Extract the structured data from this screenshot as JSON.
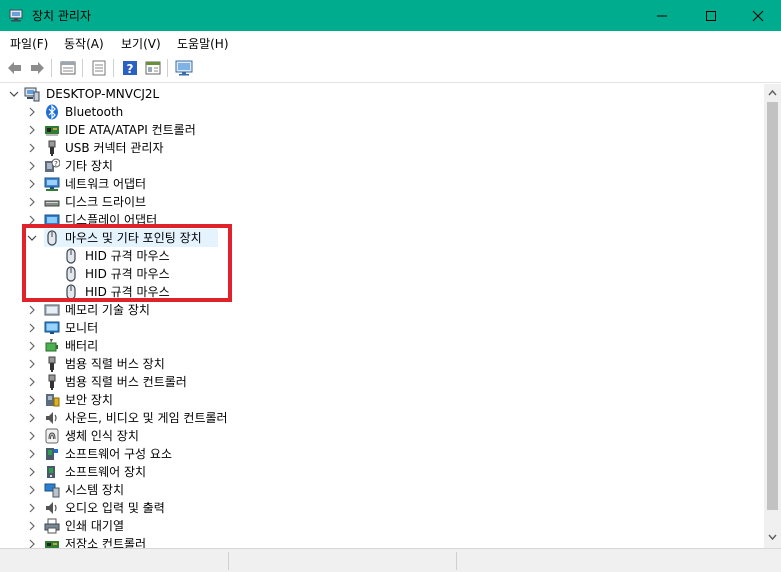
{
  "window": {
    "title": "장치 관리자",
    "accent_color": "#00ac8e"
  },
  "menu": [
    {
      "label": "파일(F)"
    },
    {
      "label": "동작(A)"
    },
    {
      "label": "보기(V)"
    },
    {
      "label": "도움말(H)"
    }
  ],
  "toolbar": {
    "icons": [
      "back-arrow-icon",
      "forward-arrow-icon",
      "properties-icon",
      "update-driver-icon",
      "help-icon",
      "view-icon",
      "monitor-scan-icon"
    ]
  },
  "tree": {
    "root": "DESKTOP-MNVCJ2L",
    "categories": [
      {
        "label": "Bluetooth",
        "icon": "bluetooth-icon"
      },
      {
        "label": "IDE ATA/ATAPI 컨트롤러",
        "icon": "ide-controller-icon"
      },
      {
        "label": "USB 커넥터 관리자",
        "icon": "usb-icon"
      },
      {
        "label": "기타 장치",
        "icon": "unknown-device-icon"
      },
      {
        "label": "네트워크 어댑터",
        "icon": "network-adapter-icon"
      },
      {
        "label": "디스크 드라이브",
        "icon": "disk-drive-icon"
      },
      {
        "label": "디스플레이 어댑터",
        "icon": "display-adapter-icon"
      },
      {
        "label": "마우스 및 기타 포인팅 장치",
        "icon": "mouse-icon",
        "expanded": true,
        "children": [
          {
            "label": "HID 규격 마우스"
          },
          {
            "label": "HID 규격 마우스"
          },
          {
            "label": "HID 규격 마우스"
          }
        ]
      },
      {
        "label": "메모리 기술 장치",
        "icon": "memory-device-icon"
      },
      {
        "label": "모니터",
        "icon": "monitor-icon"
      },
      {
        "label": "배터리",
        "icon": "battery-icon"
      },
      {
        "label": "범용 직렬 버스 장치",
        "icon": "usb-icon"
      },
      {
        "label": "범용 직렬 버스 컨트롤러",
        "icon": "usb-icon"
      },
      {
        "label": "보안 장치",
        "icon": "security-device-icon"
      },
      {
        "label": "사운드, 비디오 및 게임 컨트롤러",
        "icon": "sound-icon"
      },
      {
        "label": "생체 인식 장치",
        "icon": "fingerprint-icon"
      },
      {
        "label": "소프트웨어 구성 요소",
        "icon": "software-component-icon"
      },
      {
        "label": "소프트웨어 장치",
        "icon": "software-device-icon"
      },
      {
        "label": "시스템 장치",
        "icon": "system-device-icon"
      },
      {
        "label": "오디오 입력 및 출력",
        "icon": "audio-io-icon"
      },
      {
        "label": "인쇄 대기열",
        "icon": "printer-icon"
      },
      {
        "label": "저장소 컨트롤러",
        "icon": "storage-controller-icon"
      }
    ]
  },
  "highlight_color": "#e0222a"
}
